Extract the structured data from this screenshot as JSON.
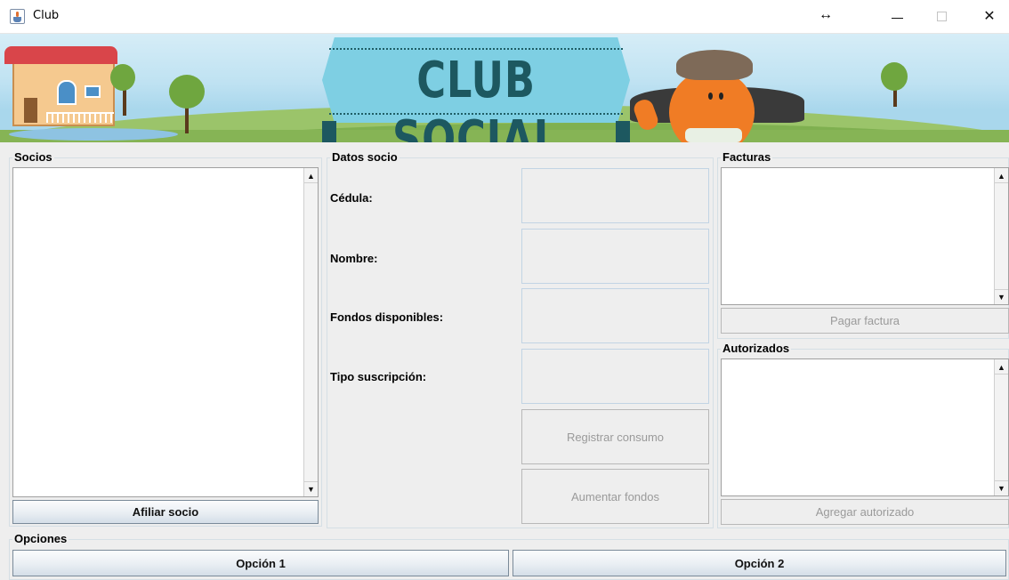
{
  "window": {
    "title": "Club",
    "resize_glyph": "↔",
    "close_glyph": "✕",
    "icons": [
      "java-app-icon",
      "minimize-icon",
      "maximize-icon",
      "close-icon"
    ]
  },
  "banner": {
    "sign_text": "CLUB SOCIAL"
  },
  "socios": {
    "title": "Socios",
    "items": [],
    "afiliar_button": "Afiliar socio"
  },
  "datos_socio": {
    "title": "Datos socio",
    "cedula_label": "Cédula:",
    "cedula_value": "",
    "nombre_label": "Nombre:",
    "nombre_value": "",
    "fondos_label": "Fondos disponibles:",
    "fondos_value": "",
    "tipo_label": "Tipo suscripción:",
    "tipo_value": "",
    "registrar_button": "Registrar consumo",
    "aumentar_button": "Aumentar fondos"
  },
  "facturas": {
    "title": "Facturas",
    "items": [],
    "pagar_button": "Pagar factura"
  },
  "autorizados": {
    "title": "Autorizados",
    "items": [],
    "agregar_button": "Agregar autorizado"
  },
  "opciones": {
    "title": "Opciones",
    "option1": "Opción 1",
    "option2": "Opción 2"
  },
  "scroll": {
    "up": "▲",
    "down": "▼"
  }
}
